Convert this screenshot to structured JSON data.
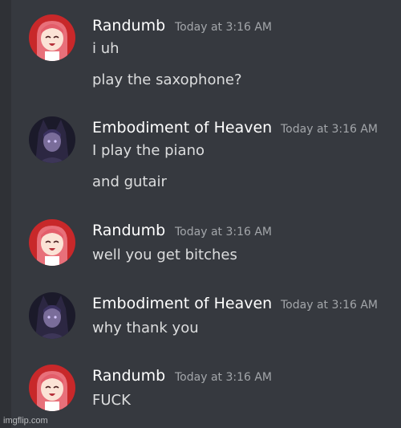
{
  "messages": [
    {
      "author": "Randumb",
      "timestamp": "Today at 3:16 AM",
      "lines": [
        "i uh",
        "play the saxophone?"
      ],
      "avatar_icon": "anime-girl-red-hair-avatar"
    },
    {
      "author": "Embodiment of Heaven",
      "timestamp": "Today at 3:16 AM",
      "lines": [
        "I play the piano",
        "and gutair"
      ],
      "avatar_icon": "anime-dark-hair-avatar"
    },
    {
      "author": "Randumb",
      "timestamp": "Today at 3:16 AM",
      "lines": [
        "well you get bitches"
      ],
      "avatar_icon": "anime-girl-red-hair-avatar"
    },
    {
      "author": "Embodiment of Heaven",
      "timestamp": "Today at 3:16 AM",
      "lines": [
        "why thank you"
      ],
      "avatar_icon": "anime-dark-hair-avatar"
    },
    {
      "author": "Randumb",
      "timestamp": "Today at 3:16 AM",
      "lines": [
        "FUCK"
      ],
      "avatar_icon": "anime-girl-red-hair-avatar"
    }
  ],
  "watermark": "imgflip.com",
  "colors": {
    "background": "#36393f",
    "username": "#ffffff",
    "timestamp": "#a3a6aa",
    "message_text": "#dcddde"
  }
}
